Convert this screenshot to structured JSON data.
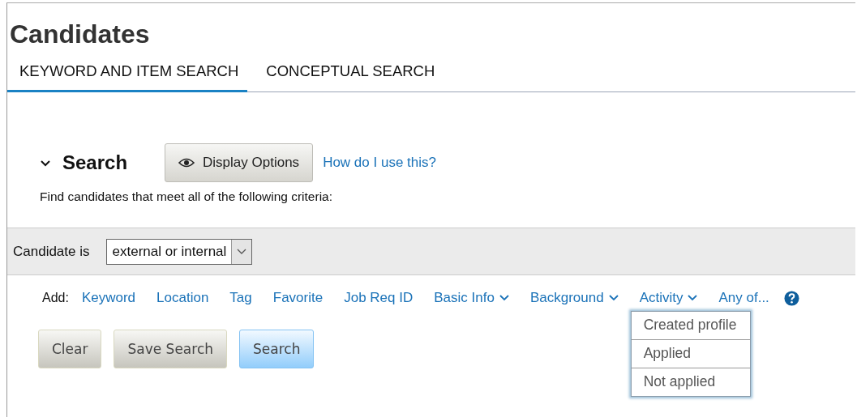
{
  "page": {
    "title": "Candidates"
  },
  "tabs": [
    {
      "label": "KEYWORD AND ITEM SEARCH",
      "selected": true
    },
    {
      "label": "CONCEPTUAL SEARCH",
      "selected": false
    }
  ],
  "search": {
    "heading": "Search",
    "expanded": true,
    "display_options": "Display Options",
    "help_link": "How do I use this?",
    "description": "Find candidates that meet all of the following criteria:"
  },
  "filter": {
    "label": "Candidate is",
    "value": "external or internal"
  },
  "add_bar": {
    "label": "Add:",
    "items": [
      {
        "label": "Keyword",
        "kind": "link"
      },
      {
        "label": "Location",
        "kind": "link"
      },
      {
        "label": "Tag",
        "kind": "link"
      },
      {
        "label": "Favorite",
        "kind": "link"
      },
      {
        "label": "Job Req ID",
        "kind": "link"
      },
      {
        "label": "Basic Info",
        "kind": "menu"
      },
      {
        "label": "Background",
        "kind": "menu"
      },
      {
        "label": "Activity",
        "kind": "menu",
        "menu_items": [
          "Created profile",
          "Applied",
          "Not applied"
        ]
      },
      {
        "label": "Any of...",
        "kind": "link"
      }
    ]
  },
  "buttons": [
    {
      "label": "Clear",
      "kind": "default"
    },
    {
      "label": "Save Search",
      "kind": "default"
    },
    {
      "label": "Search",
      "kind": "primary"
    }
  ]
}
